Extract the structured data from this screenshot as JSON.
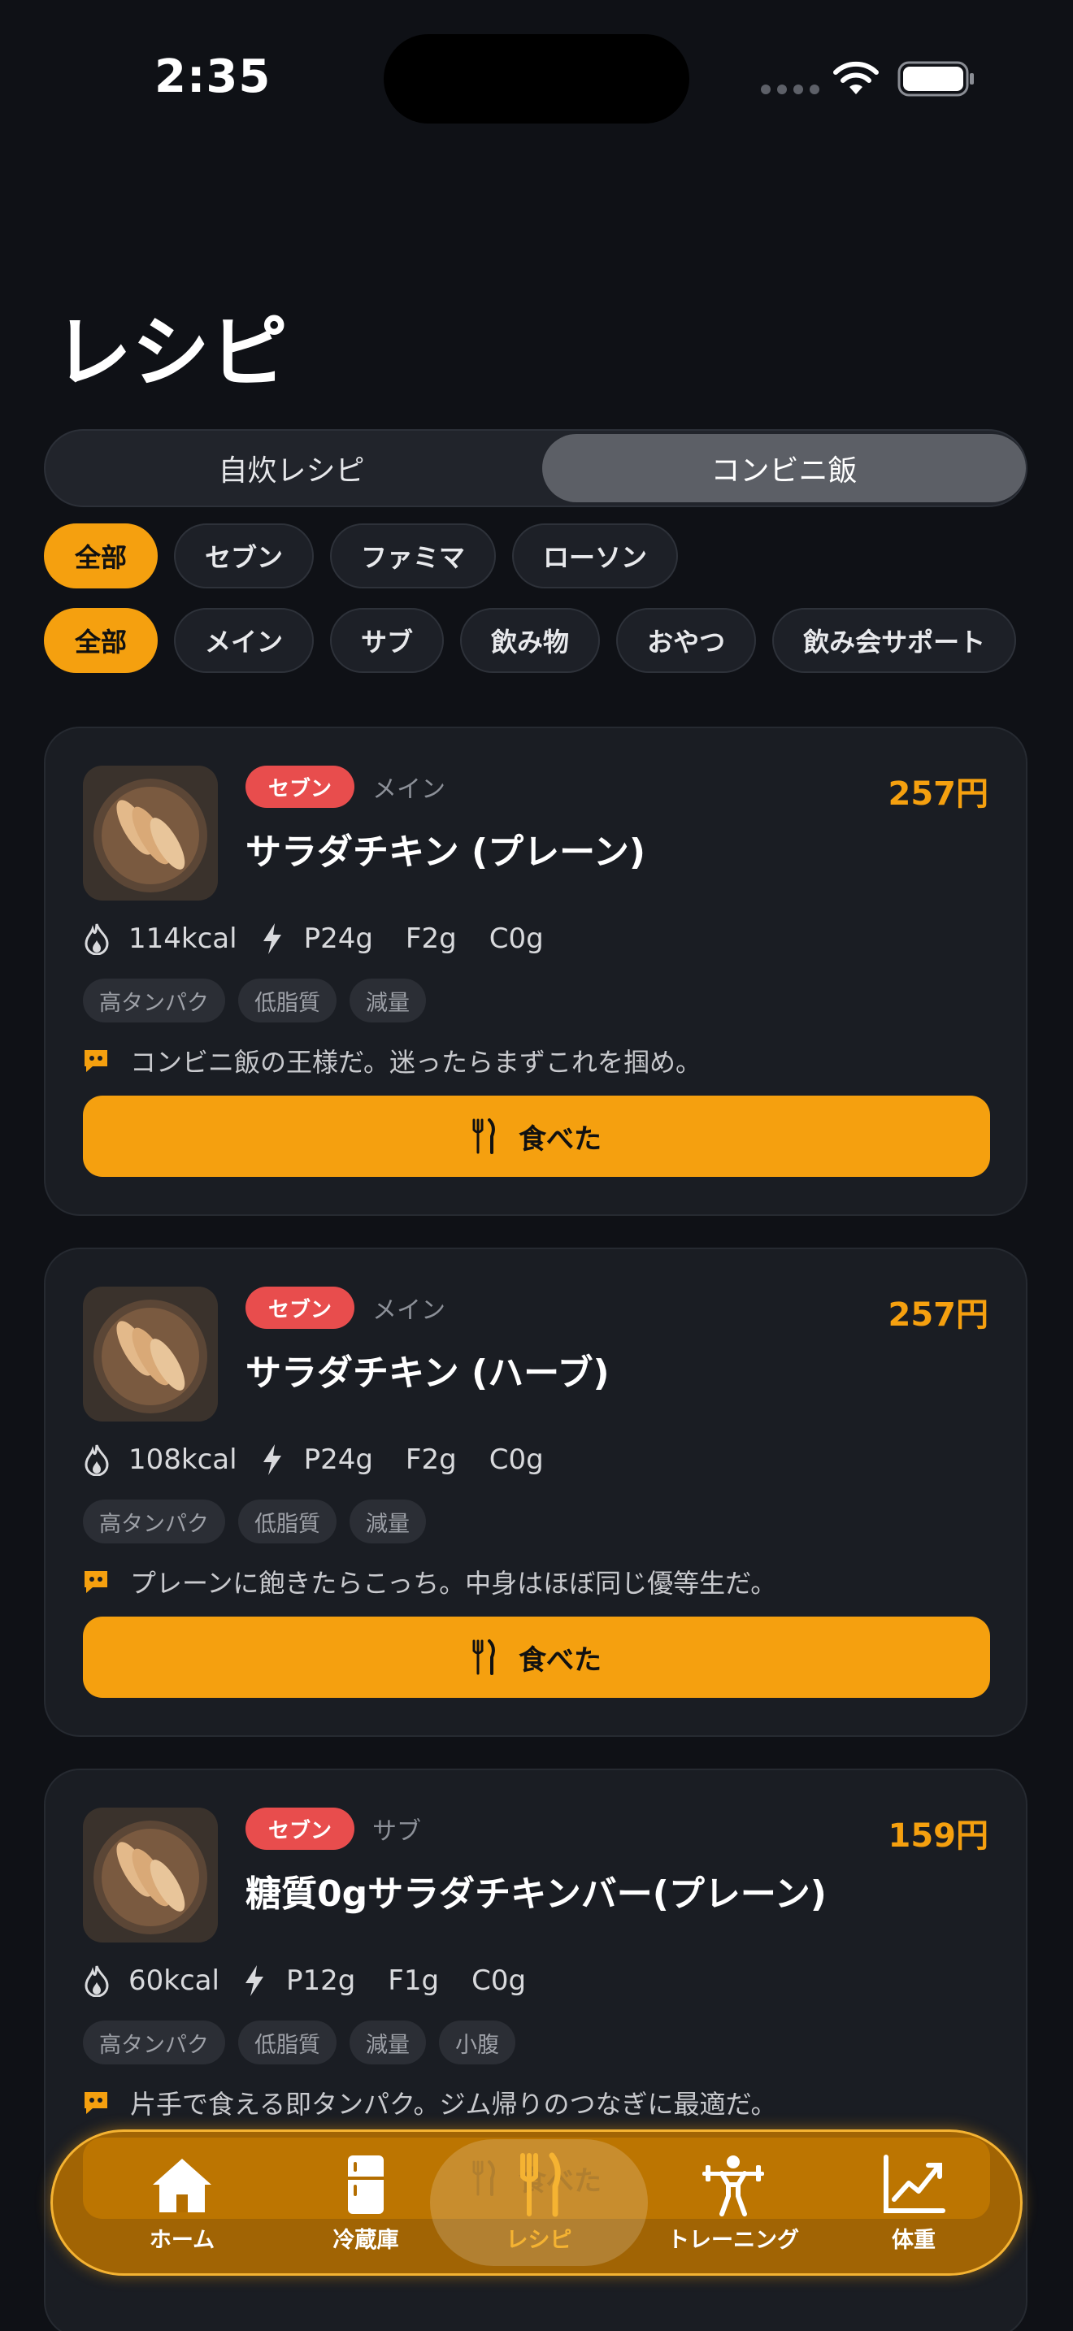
{
  "status_bar": {
    "time": "2:35"
  },
  "page_title": "レシピ",
  "segmented": {
    "left": "自炊レシピ",
    "right": "コンビニ飯",
    "selected": "コンビニ飯"
  },
  "store_filters": {
    "items": [
      "全部",
      "セブン",
      "ファミマ",
      "ローソン"
    ],
    "selected": "全部"
  },
  "type_filters": {
    "items": [
      "全部",
      "メイン",
      "サブ",
      "飲み物",
      "おやつ",
      "飲み会サポート"
    ],
    "selected": "全部"
  },
  "cards": [
    {
      "store": "セブン",
      "category": "メイン",
      "price": "257円",
      "name": "サラダチキン (プレーン)",
      "kcal": "114kcal",
      "p": "P24g",
      "f": "F2g",
      "c": "C0g",
      "tags": [
        "高タンパク",
        "低脂質",
        "減量"
      ],
      "comment": "コンビニ飯の王様だ。迷ったらまずこれを掴め。",
      "button": "食べた"
    },
    {
      "store": "セブン",
      "category": "メイン",
      "price": "257円",
      "name": "サラダチキン (ハーブ)",
      "kcal": "108kcal",
      "p": "P24g",
      "f": "F2g",
      "c": "C0g",
      "tags": [
        "高タンパク",
        "低脂質",
        "減量"
      ],
      "comment": "プレーンに飽きたらこっち。中身はほぼ同じ優等生だ。",
      "button": "食べた"
    },
    {
      "store": "セブン",
      "category": "サブ",
      "price": "159円",
      "name": "糖質0gサラダチキンバー(プレーン)",
      "kcal": "60kcal",
      "p": "P12g",
      "f": "F1g",
      "c": "C0g",
      "tags": [
        "高タンパク",
        "低脂質",
        "減量",
        "小腹"
      ],
      "comment": "片手で食える即タンパク。ジム帰りのつなぎに最適だ。",
      "button": "食べた"
    }
  ],
  "tab_bar": {
    "items": [
      {
        "label": "ホーム",
        "icon": "home-icon"
      },
      {
        "label": "冷蔵庫",
        "icon": "fridge-icon"
      },
      {
        "label": "レシピ",
        "icon": "fork-knife-icon"
      },
      {
        "label": "トレーニング",
        "icon": "weightlifting-icon"
      },
      {
        "label": "体重",
        "icon": "chart-icon"
      }
    ],
    "selected": "レシピ"
  },
  "colors": {
    "accent": "#f5a00f",
    "badge": "#e84d4d",
    "background": "#0f1116",
    "card": "#1a1d23"
  }
}
